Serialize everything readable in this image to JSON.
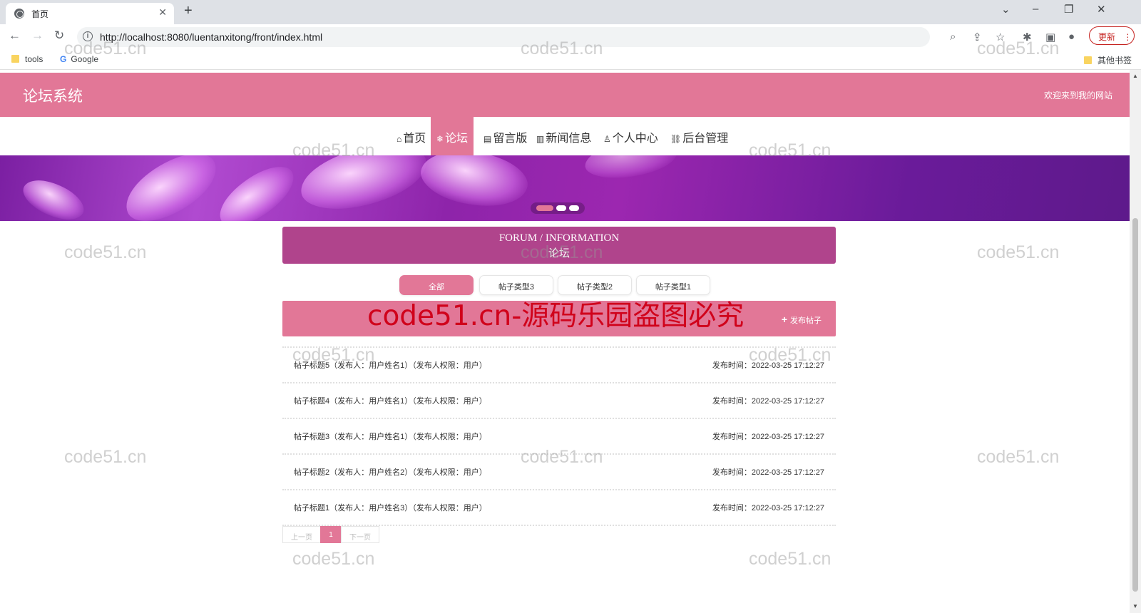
{
  "browser": {
    "tab_title": "首页",
    "url": "http://localhost:8080/luentanxitong/front/index.html",
    "update_label": "更新",
    "bookmarks": [
      "tools",
      "Google"
    ],
    "other_bookmarks": "其他书签"
  },
  "site": {
    "title": "论坛系统",
    "welcome": "欢迎来到我的网站"
  },
  "nav": [
    {
      "label": "首页",
      "icon": "home-icon",
      "glyph": "⌂"
    },
    {
      "label": "论坛",
      "icon": "snowflake-icon",
      "glyph": "❄",
      "active": true
    },
    {
      "label": "留言版",
      "icon": "board-icon",
      "glyph": "▤"
    },
    {
      "label": "新闻信息",
      "icon": "book-icon",
      "glyph": "▥"
    },
    {
      "label": "个人中心",
      "icon": "user-icon",
      "glyph": "♙"
    },
    {
      "label": "后台管理",
      "icon": "link-icon",
      "glyph": "⛓"
    }
  ],
  "section": {
    "en": "FORUM / INFORMATION",
    "cn": "论坛"
  },
  "filters": [
    "全部",
    "帖子类型3",
    "帖子类型2",
    "帖子类型1"
  ],
  "post_button": "发布帖子",
  "posts": [
    {
      "title": "帖子标题5（发布人：用户姓名1）（发布人权限：用户）",
      "time": "发布时间：2022-03-25 17:12:27"
    },
    {
      "title": "帖子标题4（发布人：用户姓名1）（发布人权限：用户）",
      "time": "发布时间：2022-03-25 17:12:27"
    },
    {
      "title": "帖子标题3（发布人：用户姓名1）（发布人权限：用户）",
      "time": "发布时间：2022-03-25 17:12:27"
    },
    {
      "title": "帖子标题2（发布人：用户姓名2）（发布人权限：用户）",
      "time": "发布时间：2022-03-25 17:12:27"
    },
    {
      "title": "帖子标题1（发布人：用户姓名3）（发布人权限：用户）",
      "time": "发布时间：2022-03-25 17:12:27"
    }
  ],
  "pager": {
    "prev": "上一页",
    "current": "1",
    "next": "下一页"
  },
  "watermark": "code51.cn",
  "watermark_red": "code51.cn-源码乐园盗图必究",
  "colors": {
    "accent": "#e27797",
    "section": "#b0448c",
    "banner": "#8e24aa"
  }
}
